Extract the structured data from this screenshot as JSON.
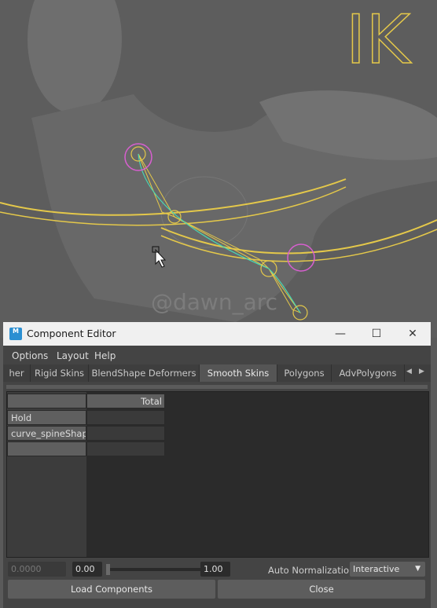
{
  "viewport": {
    "overlay_text": "IK",
    "watermark": "@dawn_arc",
    "colors": {
      "rig": "#e4c84a",
      "joint": "#d85fd0",
      "curve": "#49d7b3"
    }
  },
  "window": {
    "title": "Component Editor",
    "app_icon_text": "M",
    "controls": {
      "minimize": "—",
      "maximize": "☐",
      "close": "✕"
    }
  },
  "menu": [
    "Options",
    "Layout",
    "Help"
  ],
  "tabs": [
    {
      "label": "her",
      "active": false
    },
    {
      "label": "Rigid Skins",
      "active": false
    },
    {
      "label": "BlendShape Deformers",
      "active": false
    },
    {
      "label": "Smooth Skins",
      "active": true
    },
    {
      "label": "Polygons",
      "active": false
    },
    {
      "label": "AdvPolygons",
      "active": false
    }
  ],
  "tab_arrows": {
    "left": "◀",
    "right": "▶"
  },
  "table": {
    "column_header": "Total",
    "rows": [
      "Hold",
      "curve_spineShape",
      ""
    ]
  },
  "controls": {
    "value_field": "0.0000",
    "min": "0.00",
    "max": "1.00",
    "slider_value": 0,
    "auto_normalization_label": "Auto Normalization",
    "auto_normalization_value": "Interactive"
  },
  "buttons": {
    "load": "Load Components",
    "close": "Close"
  }
}
